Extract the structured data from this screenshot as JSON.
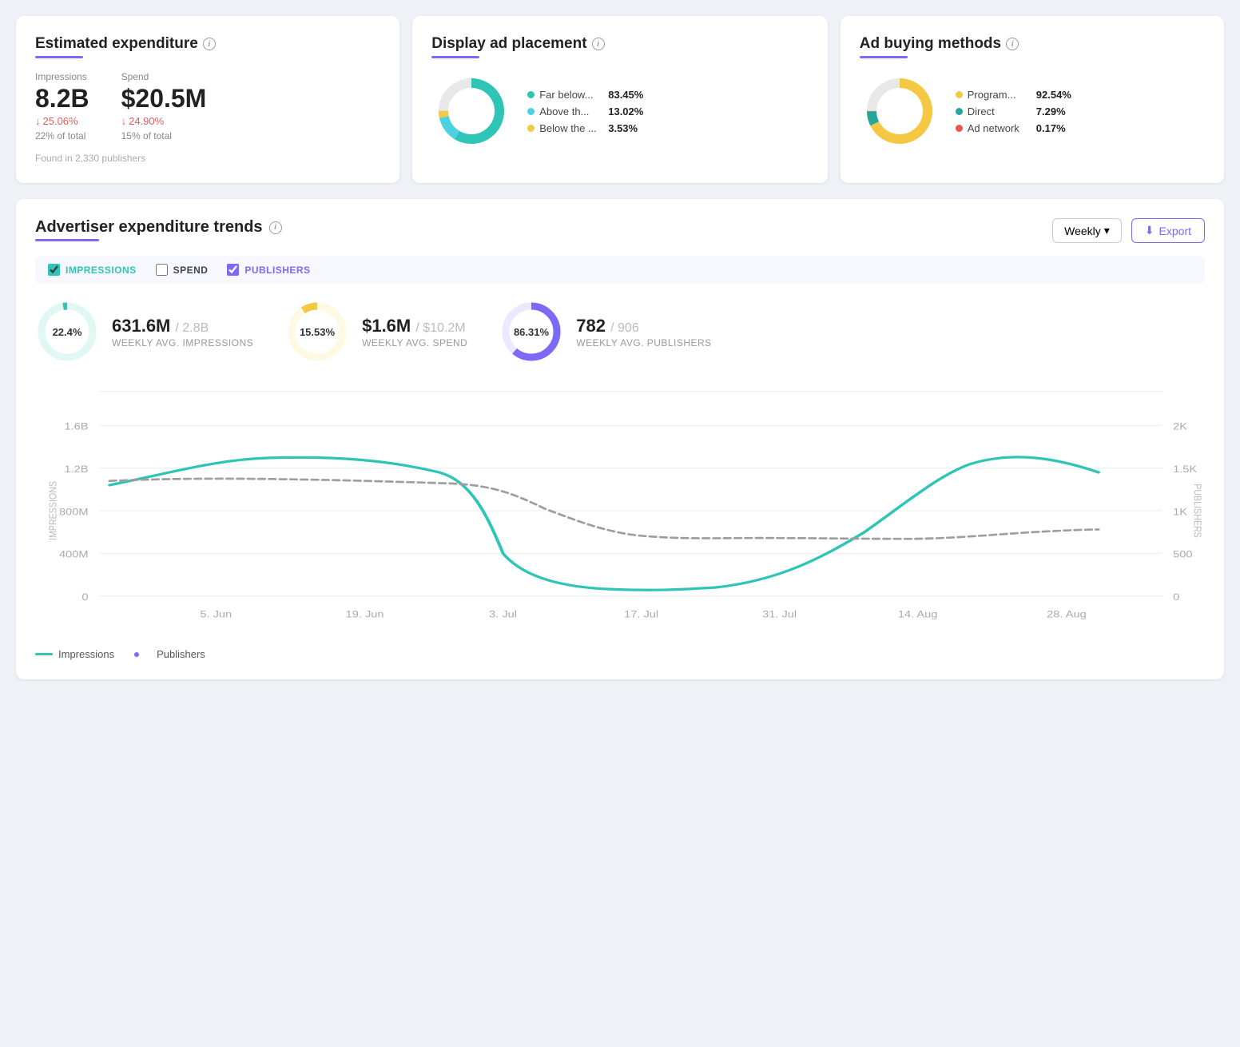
{
  "top": {
    "estimated": {
      "title": "Estimated expenditure",
      "impressions_label": "Impressions",
      "impressions_value": "8.2B",
      "impressions_change": "25.06%",
      "impressions_total": "22% of total",
      "spend_label": "Spend",
      "spend_value": "$20.5M",
      "spend_change": "24.90%",
      "spend_total": "15% of total",
      "publishers_note": "Found in 2,330 publishers"
    },
    "display": {
      "title": "Display ad placement",
      "segments": [
        {
          "label": "Far below...",
          "pct": "83.45%",
          "color": "#2ec4b6"
        },
        {
          "label": "Above th...",
          "pct": "13.02%",
          "color": "#26c6da"
        },
        {
          "label": "Below the ...",
          "pct": "3.53%",
          "color": "#f4c842"
        }
      ]
    },
    "buying": {
      "title": "Ad buying methods",
      "segments": [
        {
          "label": "Program...",
          "pct": "92.54%",
          "color": "#f4c842"
        },
        {
          "label": "Direct",
          "pct": "7.29%",
          "color": "#26a69a"
        },
        {
          "label": "Ad network",
          "pct": "0.17%",
          "color": "#ef5350"
        }
      ]
    }
  },
  "trends": {
    "title": "Advertiser expenditure trends",
    "weekly_label": "Weekly",
    "export_label": "Export",
    "checkboxes": [
      {
        "id": "impressions",
        "label": "IMPRESSIONS",
        "checked": true
      },
      {
        "id": "spend",
        "label": "SPEND",
        "checked": false
      },
      {
        "id": "publishers",
        "label": "PUBLISHERS",
        "checked": true
      }
    ],
    "metrics": [
      {
        "id": "impressions",
        "pct": "22.4%",
        "main": "631.6M",
        "total": "/ 2.8B",
        "sub": "WEEKLY AVG. IMPRESSIONS",
        "color_track": "#e0f7f4",
        "color_fill": "#2ec4b6"
      },
      {
        "id": "spend",
        "pct": "15.53%",
        "main": "$1.6M",
        "total": "/ $10.2M",
        "sub": "WEEKLY AVG. SPEND",
        "color_track": "#fef9e3",
        "color_fill": "#f4c842"
      },
      {
        "id": "publishers",
        "pct": "86.31%",
        "main": "782",
        "total": "/ 906",
        "sub": "WEEKLY AVG. PUBLISHERS",
        "color_track": "#ede8fd",
        "color_fill": "#7c6af7"
      }
    ],
    "chart": {
      "x_labels": [
        "5. Jun",
        "19. Jun",
        "3. Jul",
        "17. Jul",
        "31. Jul",
        "14. Aug",
        "28. Aug"
      ],
      "y_left_labels": [
        "0",
        "400M",
        "800M",
        "1.2B",
        "1.6B"
      ],
      "y_right_labels": [
        "0",
        "500",
        "1K",
        "1.5K",
        "2K"
      ],
      "impressions_axis": "IMPRESSIONS",
      "publishers_axis": "PUBLISHERS"
    },
    "legend": [
      {
        "label": "Impressions",
        "type": "solid",
        "color": "#2ec4b6"
      },
      {
        "label": "Publishers",
        "type": "dotted",
        "color": "#7c6af7"
      }
    ]
  }
}
